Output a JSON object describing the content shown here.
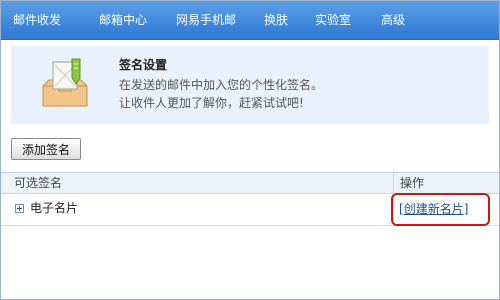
{
  "nav": {
    "items": [
      {
        "label": "邮件收发"
      },
      {
        "label": "邮箱中心"
      },
      {
        "label": "网易手机邮"
      },
      {
        "label": "换肤"
      },
      {
        "label": "实验室"
      },
      {
        "label": "高级"
      }
    ]
  },
  "banner": {
    "icon": "signature-envelope-icon",
    "title": "签名设置",
    "line1": "在发送的邮件中加入您的个性化签名。",
    "line2": "让收件人更加了解你，赶紧试试吧!"
  },
  "toolbar": {
    "add_label": "添加签名"
  },
  "table": {
    "headers": {
      "signature": "可选签名",
      "action": "操作"
    },
    "rows": [
      {
        "label": "电子名片",
        "action_open": "[",
        "action_label": "创建新名片",
        "action_close": "]"
      }
    ]
  },
  "colors": {
    "nav_bg": "#3a86dc",
    "banner_bg": "#e9f2fc",
    "link": "#1a4f9c",
    "highlight": "#c81818"
  }
}
